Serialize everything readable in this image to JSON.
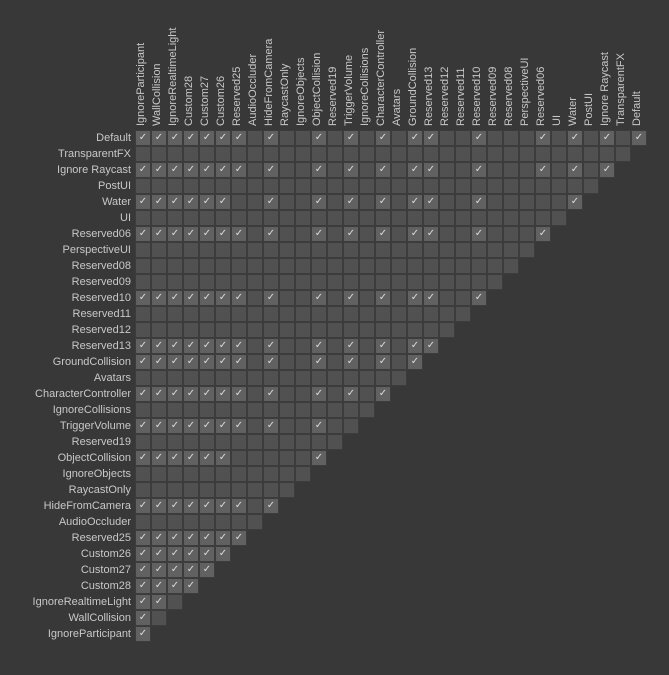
{
  "layers": [
    "Default",
    "TransparentFX",
    "Ignore Raycast",
    "PostUI",
    "Water",
    "UI",
    "Reserved06",
    "PerspectiveUI",
    "Reserved08",
    "Reserved09",
    "Reserved10",
    "Reserved11",
    "Reserved12",
    "Reserved13",
    "GroundCollision",
    "Avatars",
    "CharacterController",
    "IgnoreCollisions",
    "TriggerVolume",
    "Reserved19",
    "ObjectCollision",
    "IgnoreObjects",
    "RaycastOnly",
    "HideFromCamera",
    "AudioOccluder",
    "Reserved25",
    "Custom26",
    "Custom27",
    "Custom28",
    "IgnoreRealtimeLight",
    "WallCollision",
    "IgnoreParticipant"
  ],
  "columns": [
    "IgnoreParticipant",
    "WallCollision",
    "IgnoreRealtimeLight",
    "Custom28",
    "Custom27",
    "Custom26",
    "Reserved25",
    "AudioOccluder",
    "HideFromCamera",
    "RaycastOnly",
    "IgnoreObjects",
    "ObjectCollision",
    "Reserved19",
    "TriggerVolume",
    "IgnoreCollisions",
    "CharacterController",
    "Avatars",
    "GroundCollision",
    "Reserved13",
    "Reserved12",
    "Reserved11",
    "Reserved10",
    "Reserved09",
    "Reserved08",
    "PerspectiveUI",
    "Reserved06",
    "UI",
    "Water",
    "PostUI",
    "Ignore Raycast",
    "TransparentFX",
    "Default"
  ],
  "checkedPairs": [
    [
      "Default",
      "Default"
    ],
    [
      "Default",
      "Ignore Raycast"
    ],
    [
      "Default",
      "Water"
    ],
    [
      "Default",
      "Reserved06"
    ],
    [
      "Default",
      "Reserved10"
    ],
    [
      "Default",
      "Reserved13"
    ],
    [
      "Default",
      "GroundCollision"
    ],
    [
      "Default",
      "CharacterController"
    ],
    [
      "Default",
      "TriggerVolume"
    ],
    [
      "Default",
      "ObjectCollision"
    ],
    [
      "Default",
      "HideFromCamera"
    ],
    [
      "Default",
      "Reserved25"
    ],
    [
      "Default",
      "Custom26"
    ],
    [
      "Default",
      "Custom27"
    ],
    [
      "Default",
      "Custom28"
    ],
    [
      "Default",
      "IgnoreRealtimeLight"
    ],
    [
      "Default",
      "WallCollision"
    ],
    [
      "Default",
      "IgnoreParticipant"
    ],
    [
      "Ignore Raycast",
      "Ignore Raycast"
    ],
    [
      "Ignore Raycast",
      "Water"
    ],
    [
      "Ignore Raycast",
      "Reserved06"
    ],
    [
      "Ignore Raycast",
      "Reserved10"
    ],
    [
      "Ignore Raycast",
      "Reserved13"
    ],
    [
      "Ignore Raycast",
      "GroundCollision"
    ],
    [
      "Ignore Raycast",
      "CharacterController"
    ],
    [
      "Ignore Raycast",
      "TriggerVolume"
    ],
    [
      "Ignore Raycast",
      "ObjectCollision"
    ],
    [
      "Ignore Raycast",
      "HideFromCamera"
    ],
    [
      "Ignore Raycast",
      "Reserved25"
    ],
    [
      "Ignore Raycast",
      "Custom26"
    ],
    [
      "Ignore Raycast",
      "Custom27"
    ],
    [
      "Ignore Raycast",
      "Custom28"
    ],
    [
      "Ignore Raycast",
      "IgnoreRealtimeLight"
    ],
    [
      "Ignore Raycast",
      "WallCollision"
    ],
    [
      "Ignore Raycast",
      "IgnoreParticipant"
    ],
    [
      "Water",
      "Water"
    ],
    [
      "Water",
      "Reserved10"
    ],
    [
      "Water",
      "Reserved13"
    ],
    [
      "Water",
      "GroundCollision"
    ],
    [
      "Water",
      "CharacterController"
    ],
    [
      "Water",
      "TriggerVolume"
    ],
    [
      "Water",
      "ObjectCollision"
    ],
    [
      "Water",
      "HideFromCamera"
    ],
    [
      "Water",
      "Custom26"
    ],
    [
      "Water",
      "Custom27"
    ],
    [
      "Water",
      "Custom28"
    ],
    [
      "Water",
      "IgnoreRealtimeLight"
    ],
    [
      "Water",
      "WallCollision"
    ],
    [
      "Water",
      "IgnoreParticipant"
    ],
    [
      "Reserved06",
      "Reserved06"
    ],
    [
      "Reserved06",
      "Reserved10"
    ],
    [
      "Reserved06",
      "Reserved13"
    ],
    [
      "Reserved06",
      "GroundCollision"
    ],
    [
      "Reserved06",
      "CharacterController"
    ],
    [
      "Reserved06",
      "TriggerVolume"
    ],
    [
      "Reserved06",
      "ObjectCollision"
    ],
    [
      "Reserved06",
      "HideFromCamera"
    ],
    [
      "Reserved06",
      "Reserved25"
    ],
    [
      "Reserved06",
      "Custom26"
    ],
    [
      "Reserved06",
      "Custom27"
    ],
    [
      "Reserved06",
      "Custom28"
    ],
    [
      "Reserved06",
      "IgnoreRealtimeLight"
    ],
    [
      "Reserved06",
      "WallCollision"
    ],
    [
      "Reserved06",
      "IgnoreParticipant"
    ],
    [
      "Reserved10",
      "Reserved10"
    ],
    [
      "Reserved10",
      "Reserved13"
    ],
    [
      "Reserved10",
      "GroundCollision"
    ],
    [
      "Reserved10",
      "CharacterController"
    ],
    [
      "Reserved10",
      "TriggerVolume"
    ],
    [
      "Reserved10",
      "ObjectCollision"
    ],
    [
      "Reserved10",
      "HideFromCamera"
    ],
    [
      "Reserved10",
      "Reserved25"
    ],
    [
      "Reserved10",
      "Custom26"
    ],
    [
      "Reserved10",
      "Custom27"
    ],
    [
      "Reserved10",
      "Custom28"
    ],
    [
      "Reserved10",
      "IgnoreRealtimeLight"
    ],
    [
      "Reserved10",
      "WallCollision"
    ],
    [
      "Reserved10",
      "IgnoreParticipant"
    ],
    [
      "Reserved13",
      "Reserved13"
    ],
    [
      "Reserved13",
      "GroundCollision"
    ],
    [
      "Reserved13",
      "CharacterController"
    ],
    [
      "Reserved13",
      "TriggerVolume"
    ],
    [
      "Reserved13",
      "ObjectCollision"
    ],
    [
      "Reserved13",
      "HideFromCamera"
    ],
    [
      "Reserved13",
      "Reserved25"
    ],
    [
      "Reserved13",
      "Custom26"
    ],
    [
      "Reserved13",
      "Custom27"
    ],
    [
      "Reserved13",
      "Custom28"
    ],
    [
      "Reserved13",
      "IgnoreRealtimeLight"
    ],
    [
      "Reserved13",
      "WallCollision"
    ],
    [
      "Reserved13",
      "IgnoreParticipant"
    ],
    [
      "GroundCollision",
      "GroundCollision"
    ],
    [
      "GroundCollision",
      "CharacterController"
    ],
    [
      "GroundCollision",
      "TriggerVolume"
    ],
    [
      "GroundCollision",
      "ObjectCollision"
    ],
    [
      "GroundCollision",
      "HideFromCamera"
    ],
    [
      "GroundCollision",
      "Reserved25"
    ],
    [
      "GroundCollision",
      "Custom26"
    ],
    [
      "GroundCollision",
      "Custom27"
    ],
    [
      "GroundCollision",
      "Custom28"
    ],
    [
      "GroundCollision",
      "IgnoreRealtimeLight"
    ],
    [
      "GroundCollision",
      "WallCollision"
    ],
    [
      "GroundCollision",
      "IgnoreParticipant"
    ],
    [
      "CharacterController",
      "CharacterController"
    ],
    [
      "CharacterController",
      "TriggerVolume"
    ],
    [
      "CharacterController",
      "ObjectCollision"
    ],
    [
      "CharacterController",
      "HideFromCamera"
    ],
    [
      "CharacterController",
      "Reserved25"
    ],
    [
      "CharacterController",
      "Custom26"
    ],
    [
      "CharacterController",
      "Custom27"
    ],
    [
      "CharacterController",
      "Custom28"
    ],
    [
      "CharacterController",
      "IgnoreRealtimeLight"
    ],
    [
      "CharacterController",
      "WallCollision"
    ],
    [
      "CharacterController",
      "IgnoreParticipant"
    ],
    [
      "TriggerVolume",
      "ObjectCollision"
    ],
    [
      "TriggerVolume",
      "HideFromCamera"
    ],
    [
      "TriggerVolume",
      "Reserved25"
    ],
    [
      "TriggerVolume",
      "Custom26"
    ],
    [
      "TriggerVolume",
      "Custom27"
    ],
    [
      "TriggerVolume",
      "Custom28"
    ],
    [
      "TriggerVolume",
      "IgnoreRealtimeLight"
    ],
    [
      "TriggerVolume",
      "WallCollision"
    ],
    [
      "TriggerVolume",
      "IgnoreParticipant"
    ],
    [
      "ObjectCollision",
      "ObjectCollision"
    ],
    [
      "ObjectCollision",
      "Custom26"
    ],
    [
      "ObjectCollision",
      "Custom27"
    ],
    [
      "ObjectCollision",
      "Custom28"
    ],
    [
      "ObjectCollision",
      "IgnoreRealtimeLight"
    ],
    [
      "ObjectCollision",
      "WallCollision"
    ],
    [
      "ObjectCollision",
      "IgnoreParticipant"
    ],
    [
      "HideFromCamera",
      "HideFromCamera"
    ],
    [
      "HideFromCamera",
      "Reserved25"
    ],
    [
      "HideFromCamera",
      "Custom26"
    ],
    [
      "HideFromCamera",
      "Custom27"
    ],
    [
      "HideFromCamera",
      "Custom28"
    ],
    [
      "HideFromCamera",
      "IgnoreRealtimeLight"
    ],
    [
      "HideFromCamera",
      "WallCollision"
    ],
    [
      "HideFromCamera",
      "IgnoreParticipant"
    ],
    [
      "Reserved25",
      "Reserved25"
    ],
    [
      "Reserved25",
      "Custom26"
    ],
    [
      "Reserved25",
      "Custom27"
    ],
    [
      "Reserved25",
      "Custom28"
    ],
    [
      "Reserved25",
      "IgnoreRealtimeLight"
    ],
    [
      "Reserved25",
      "WallCollision"
    ],
    [
      "Reserved25",
      "IgnoreParticipant"
    ],
    [
      "Custom26",
      "Custom26"
    ],
    [
      "Custom26",
      "Custom27"
    ],
    [
      "Custom26",
      "Custom28"
    ],
    [
      "Custom26",
      "IgnoreRealtimeLight"
    ],
    [
      "Custom26",
      "WallCollision"
    ],
    [
      "Custom26",
      "IgnoreParticipant"
    ],
    [
      "Custom27",
      "Custom27"
    ],
    [
      "Custom27",
      "Custom28"
    ],
    [
      "Custom27",
      "IgnoreRealtimeLight"
    ],
    [
      "Custom27",
      "WallCollision"
    ],
    [
      "Custom27",
      "IgnoreParticipant"
    ],
    [
      "Custom28",
      "Custom28"
    ],
    [
      "Custom28",
      "IgnoreRealtimeLight"
    ],
    [
      "Custom28",
      "WallCollision"
    ],
    [
      "Custom28",
      "IgnoreParticipant"
    ],
    [
      "IgnoreRealtimeLight",
      "WallCollision"
    ],
    [
      "IgnoreRealtimeLight",
      "IgnoreParticipant"
    ],
    [
      "WallCollision",
      "IgnoreParticipant"
    ],
    [
      "IgnoreParticipant",
      "IgnoreParticipant"
    ]
  ],
  "colors": {
    "bg": "#383838",
    "cell": "#515151",
    "cellChecked": "#616161",
    "text": "#c8c8c8",
    "check": "#dcdcdc"
  }
}
